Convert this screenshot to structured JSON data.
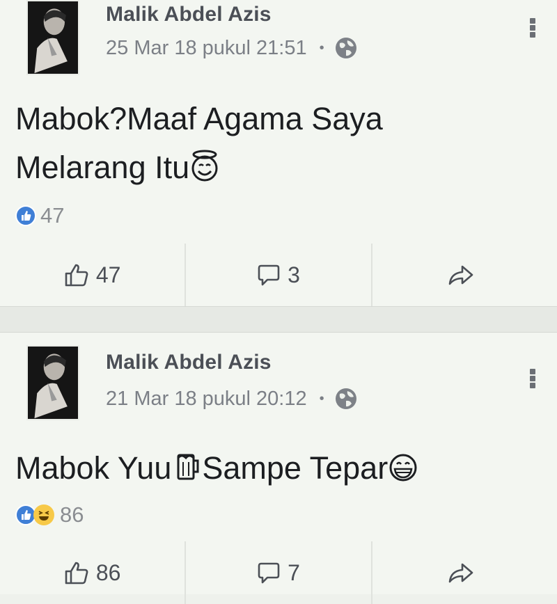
{
  "posts": [
    {
      "author": "Malik Abdel Azis",
      "timestamp": "25 Mar 18 pukul 21:51",
      "text_line1": "Mabok?Maaf Agama Saya",
      "text_line2": "Melarang Itu",
      "text_emoji": "smiling-face-with-halo",
      "reaction_types": [
        "like"
      ],
      "reaction_count": "47",
      "like_count": "47",
      "comment_count": "3"
    },
    {
      "author": "Malik Abdel Azis",
      "timestamp": "21 Mar 18 pukul 20:12",
      "text_part1": "Mabok Yuu",
      "text_part2": "Sampe Tepar",
      "text_emoji1": "beer-mug",
      "text_emoji2": "grinning-face-with-teeth",
      "reaction_types": [
        "like",
        "haha"
      ],
      "reaction_count": "86",
      "like_count": "86",
      "comment_count": "7"
    }
  ],
  "colors": {
    "like_blue": "#3f7fd6",
    "haha_yellow": "#f7c948",
    "author_gray": "#4b4f56",
    "meta_gray": "#7b7f86"
  }
}
